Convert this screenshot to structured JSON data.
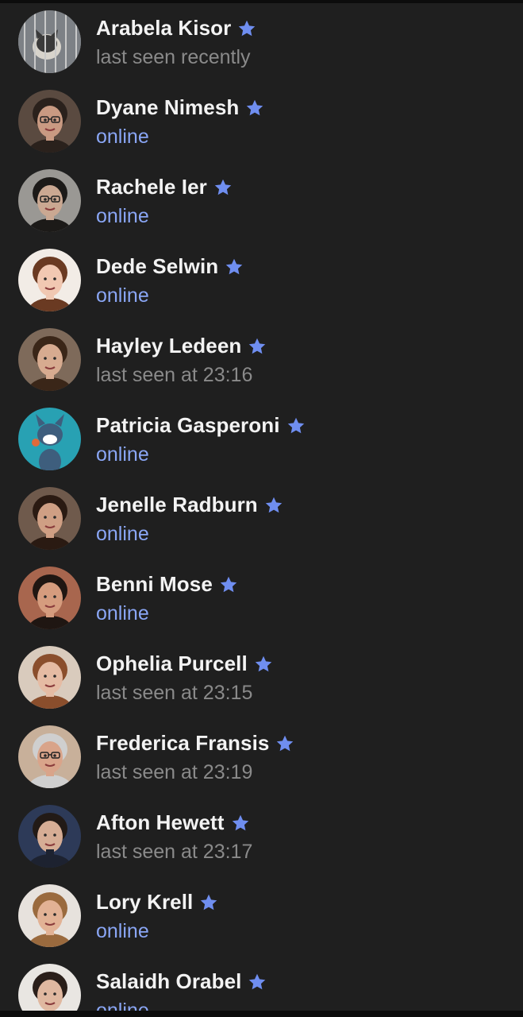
{
  "colors": {
    "background": "#1f1f1f",
    "name_text": "#f3f3f3",
    "online_status": "#8aa6f5",
    "offline_status": "#8a8a8a",
    "star": "#6f8ef0"
  },
  "contacts": [
    {
      "name": "Arabela Kisor",
      "status": "last seen recently",
      "online": false,
      "avatar": "cat-photo-avatar",
      "favorite_icon": "star-icon"
    },
    {
      "name": "Dyane Nimesh",
      "status": "online",
      "online": true,
      "avatar": "man-glasses-avatar",
      "favorite_icon": "star-icon"
    },
    {
      "name": "Rachele Ier",
      "status": "online",
      "online": true,
      "avatar": "woman-glasses-avatar",
      "favorite_icon": "star-icon"
    },
    {
      "name": "Dede Selwin",
      "status": "online",
      "online": true,
      "avatar": "toddler-avatar",
      "favorite_icon": "star-icon"
    },
    {
      "name": "Hayley Ledeen",
      "status": "last seen at 23:16",
      "online": false,
      "avatar": "woman-smiling-avatar",
      "favorite_icon": "star-icon"
    },
    {
      "name": "Patricia Gasperoni",
      "status": "online",
      "online": true,
      "avatar": "cartoon-cat-avatar",
      "favorite_icon": "star-icon"
    },
    {
      "name": "Jenelle Radburn",
      "status": "online",
      "online": true,
      "avatar": "woman-dark-hair-avatar",
      "favorite_icon": "star-icon"
    },
    {
      "name": "Benni Mose",
      "status": "online",
      "online": true,
      "avatar": "man-smiling-avatar",
      "favorite_icon": "star-icon"
    },
    {
      "name": "Ophelia Purcell",
      "status": "last seen at 23:15",
      "online": false,
      "avatar": "woman-auburn-avatar",
      "favorite_icon": "star-icon"
    },
    {
      "name": "Frederica Fransis",
      "status": "last seen at 23:19",
      "online": false,
      "avatar": "older-man-glasses-avatar",
      "favorite_icon": "star-icon"
    },
    {
      "name": "Afton Hewett",
      "status": "last seen at 23:17",
      "online": false,
      "avatar": "man-suit-avatar",
      "favorite_icon": "star-icon"
    },
    {
      "name": "Lory Krell",
      "status": "online",
      "online": true,
      "avatar": "woman-blonde-avatar",
      "favorite_icon": "star-icon"
    },
    {
      "name": "Salaidh Orabel",
      "status": "online",
      "online": true,
      "avatar": "woman-headband-avatar",
      "favorite_icon": "star-icon"
    }
  ]
}
